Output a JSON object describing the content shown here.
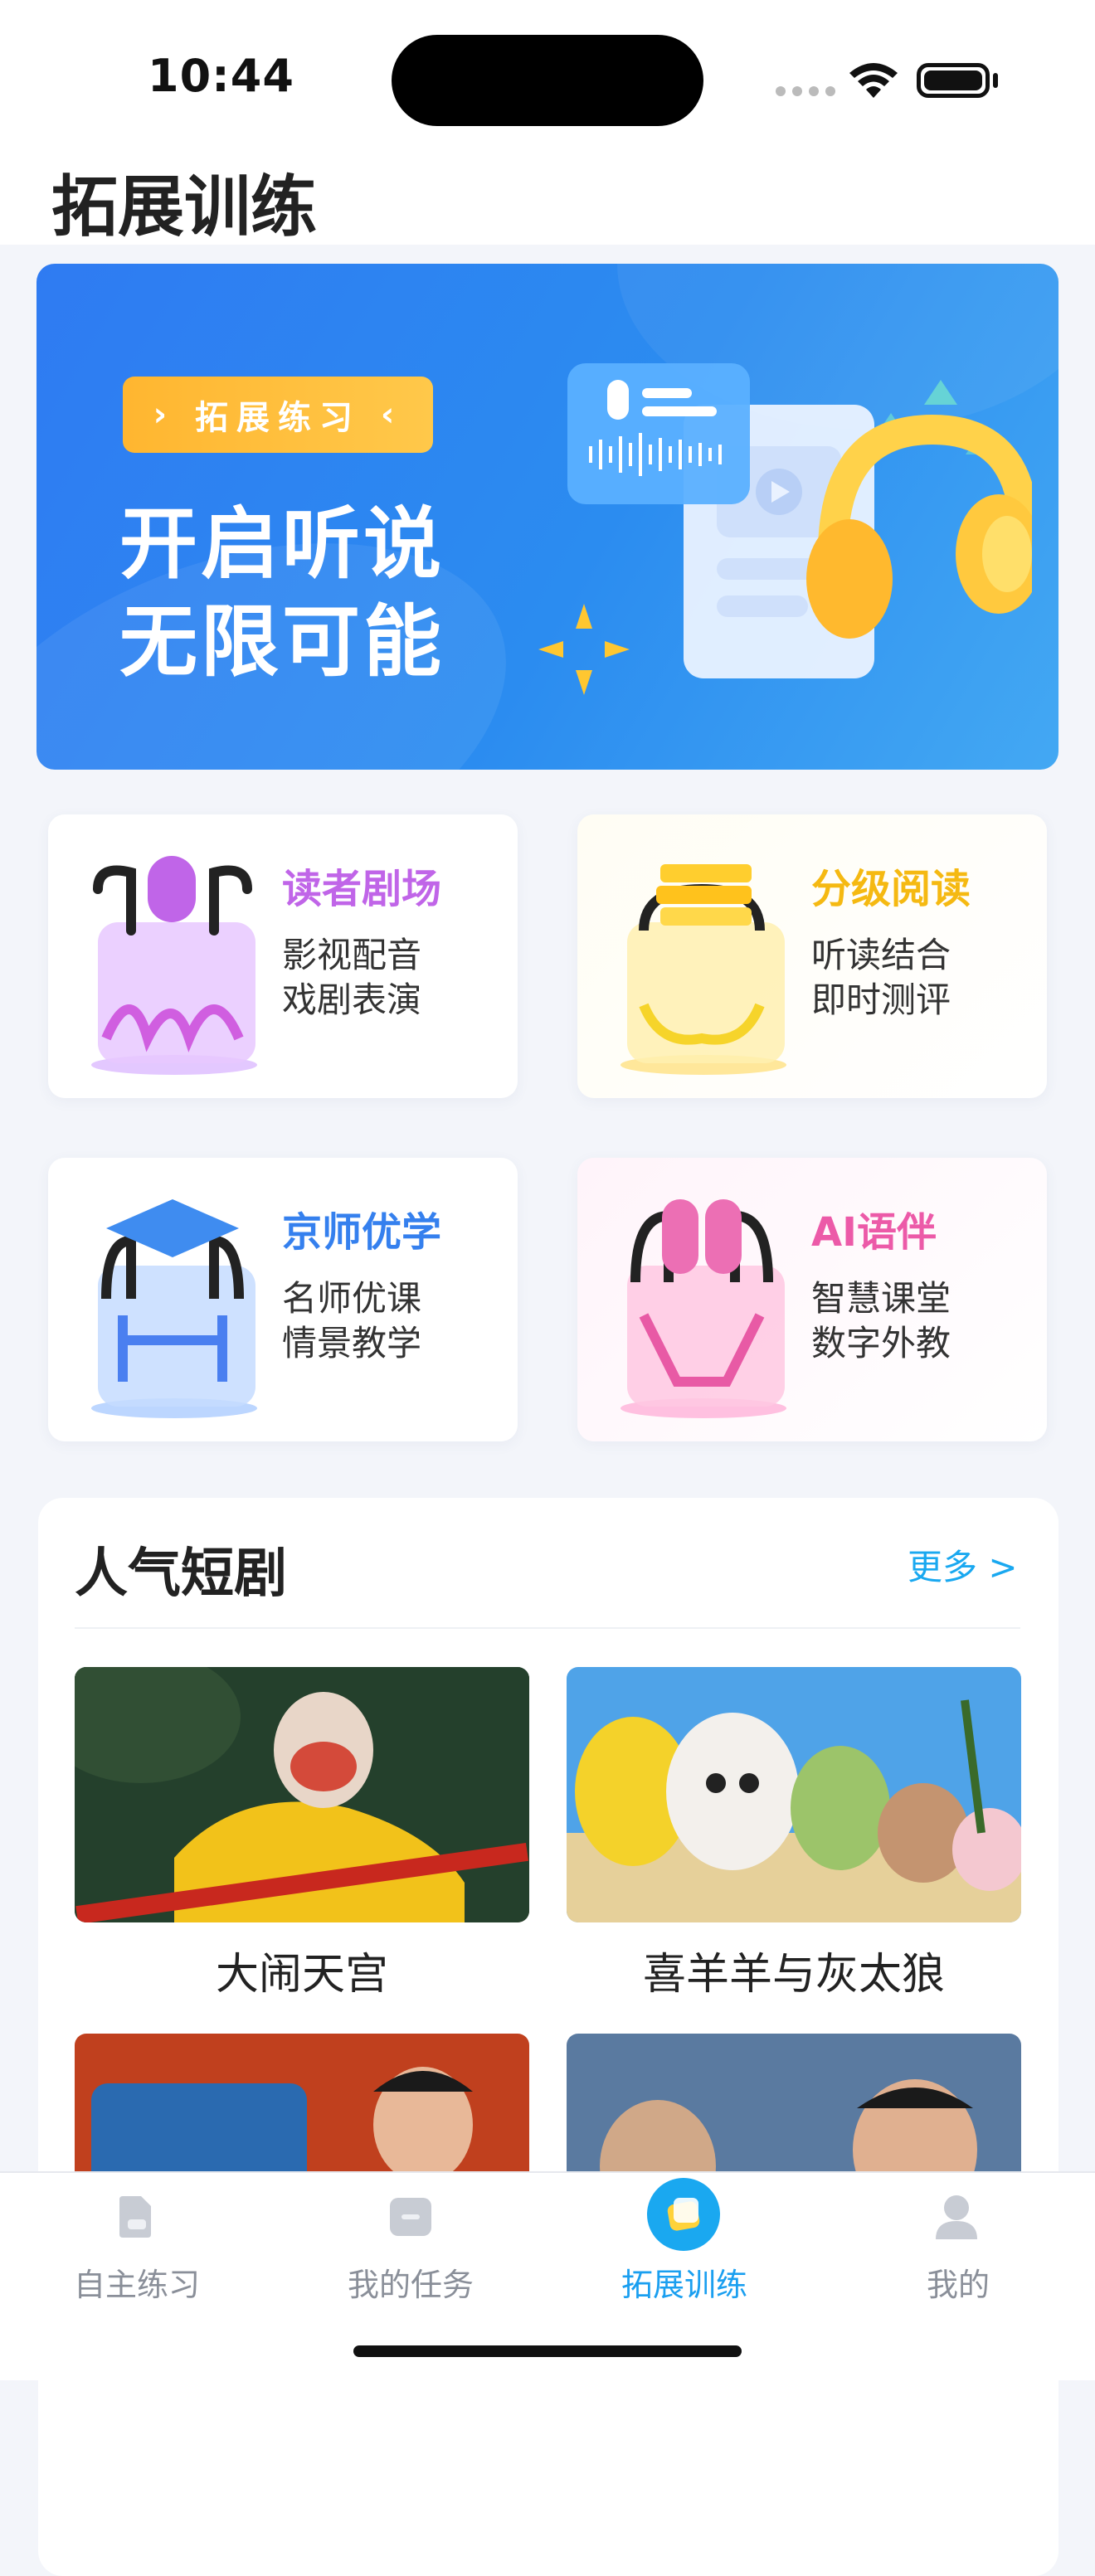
{
  "status": {
    "time": "10:44"
  },
  "page": {
    "title": "拓展训练"
  },
  "banner": {
    "tag": "拓展练习",
    "line1": "开启听说",
    "line2": "无限可能"
  },
  "features": [
    {
      "title": "读者剧场",
      "sub1": "影视配音",
      "sub2": "戏剧表演",
      "color": "#c065e8"
    },
    {
      "title": "分级阅读",
      "sub1": "听读结合",
      "sub2": "即时测评",
      "color": "#f5b912"
    },
    {
      "title": "京师优学",
      "sub1": "名师优课",
      "sub2": "情景教学",
      "color": "#3580ee"
    },
    {
      "title": "AI语伴",
      "sub1": "智慧课堂",
      "sub2": "数字外教",
      "color": "#ec5aa8"
    }
  ],
  "drama": {
    "title": "人气短剧",
    "more": "更多 >",
    "items": [
      {
        "caption": "大闹天宫"
      },
      {
        "caption": "喜羊羊与灰太狼"
      },
      {
        "caption": ""
      },
      {
        "caption": ""
      }
    ]
  },
  "tabs": [
    {
      "label": "自主练习",
      "icon": "document-icon"
    },
    {
      "label": "我的任务",
      "icon": "folder-icon"
    },
    {
      "label": "拓展训练",
      "icon": "expand-training-icon"
    },
    {
      "label": "我的",
      "icon": "person-icon"
    }
  ]
}
